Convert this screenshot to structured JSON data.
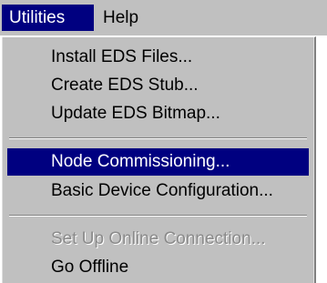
{
  "menubar": {
    "items": [
      {
        "label": "Utilities",
        "active": true
      },
      {
        "label": "Help",
        "active": false
      }
    ]
  },
  "menu": {
    "items": [
      {
        "label": "Install EDS Files...",
        "state": "normal"
      },
      {
        "label": "Create EDS Stub...",
        "state": "normal"
      },
      {
        "label": "Update EDS Bitmap...",
        "state": "normal"
      },
      {
        "label": "Node Commissioning...",
        "state": "highlighted"
      },
      {
        "label": "Basic Device Configuration...",
        "state": "normal"
      },
      {
        "label": "Set Up Online Connection...",
        "state": "disabled"
      },
      {
        "label": "Go Offline",
        "state": "normal"
      }
    ]
  },
  "colors": {
    "menu_face": "#c0c0c0",
    "highlight": "#000080",
    "highlight_text": "#ffffff",
    "disabled_text": "#8a8a8a"
  }
}
